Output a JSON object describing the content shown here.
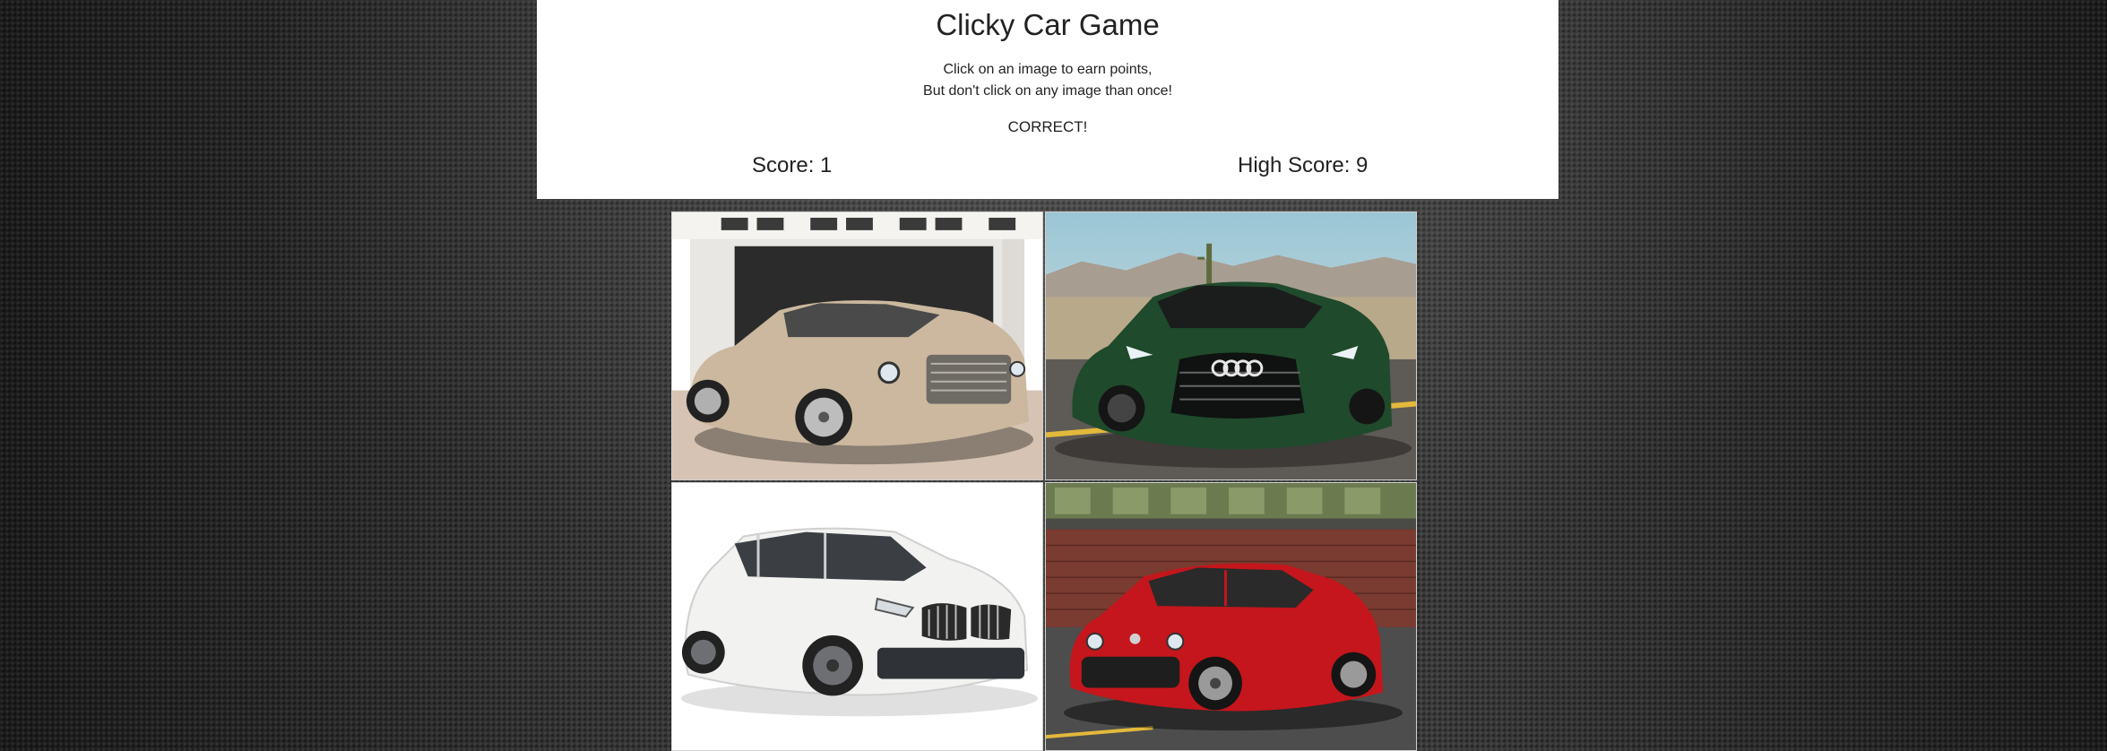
{
  "header": {
    "title": "Clicky Car Game",
    "instruction_line1": "Click on an image to earn points,",
    "instruction_line2": "But don't click on any image than once!",
    "status": "CORRECT!",
    "score_text": "Score: 1",
    "high_score_text": "High Score: 9"
  },
  "cards": [
    {
      "name": "champagne-luxury-sedan-image",
      "color": "#cbb89e"
    },
    {
      "name": "green-sport-coupe-image",
      "color": "#1f4a2b"
    },
    {
      "name": "white-compact-suv-image",
      "color": "#f2f2f0"
    },
    {
      "name": "red-crossover-image",
      "color": "#c4161c"
    }
  ]
}
